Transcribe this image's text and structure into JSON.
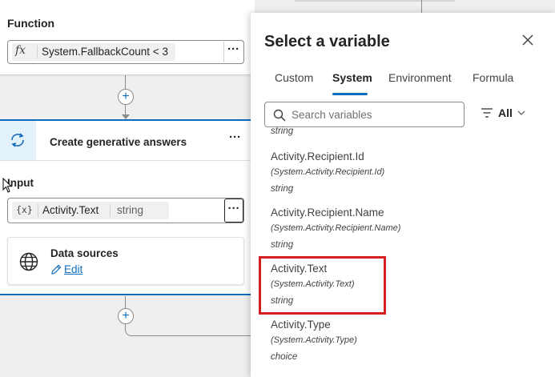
{
  "canvas": {
    "function_card": {
      "label": "Function",
      "fx_symbol": "fx",
      "expression": "System.FallbackCount < 3",
      "more_label": "···"
    },
    "add_node_symbol": "+",
    "gen_card": {
      "title": "Create generative answers",
      "more_label": "···",
      "input_label": "Input",
      "input_chip": {
        "icon_text": "{x}",
        "name": "Activity.Text",
        "type": "string"
      },
      "input_more_label": "···",
      "data_sources": {
        "title": "Data sources",
        "edit_label": "Edit"
      }
    }
  },
  "panel": {
    "title": "Select a variable",
    "tabs": [
      {
        "label": "Custom",
        "active": false
      },
      {
        "label": "System",
        "active": true
      },
      {
        "label": "Environment",
        "active": false
      },
      {
        "label": "Formula",
        "active": false
      }
    ],
    "search": {
      "placeholder": "Search variables",
      "value": ""
    },
    "filter": {
      "label": "All"
    },
    "list_fragment_type": "string",
    "variables": [
      {
        "name": "Activity.Recipient.Id",
        "path": "(System.Activity.Recipient.Id)",
        "type": "string",
        "highlighted": false
      },
      {
        "name": "Activity.Recipient.Name",
        "path": "(System.Activity.Recipient.Name)",
        "type": "string",
        "highlighted": false
      },
      {
        "name": "Activity.Text",
        "path": "(System.Activity.Text)",
        "type": "string",
        "highlighted": true
      },
      {
        "name": "Activity.Type",
        "path": "(System.Activity.Type)",
        "type": "choice",
        "highlighted": false
      }
    ]
  },
  "colors": {
    "accent": "#0f6cbd",
    "highlight_box": "#d21f1f",
    "card_header_bg": "#e3f1fb"
  }
}
